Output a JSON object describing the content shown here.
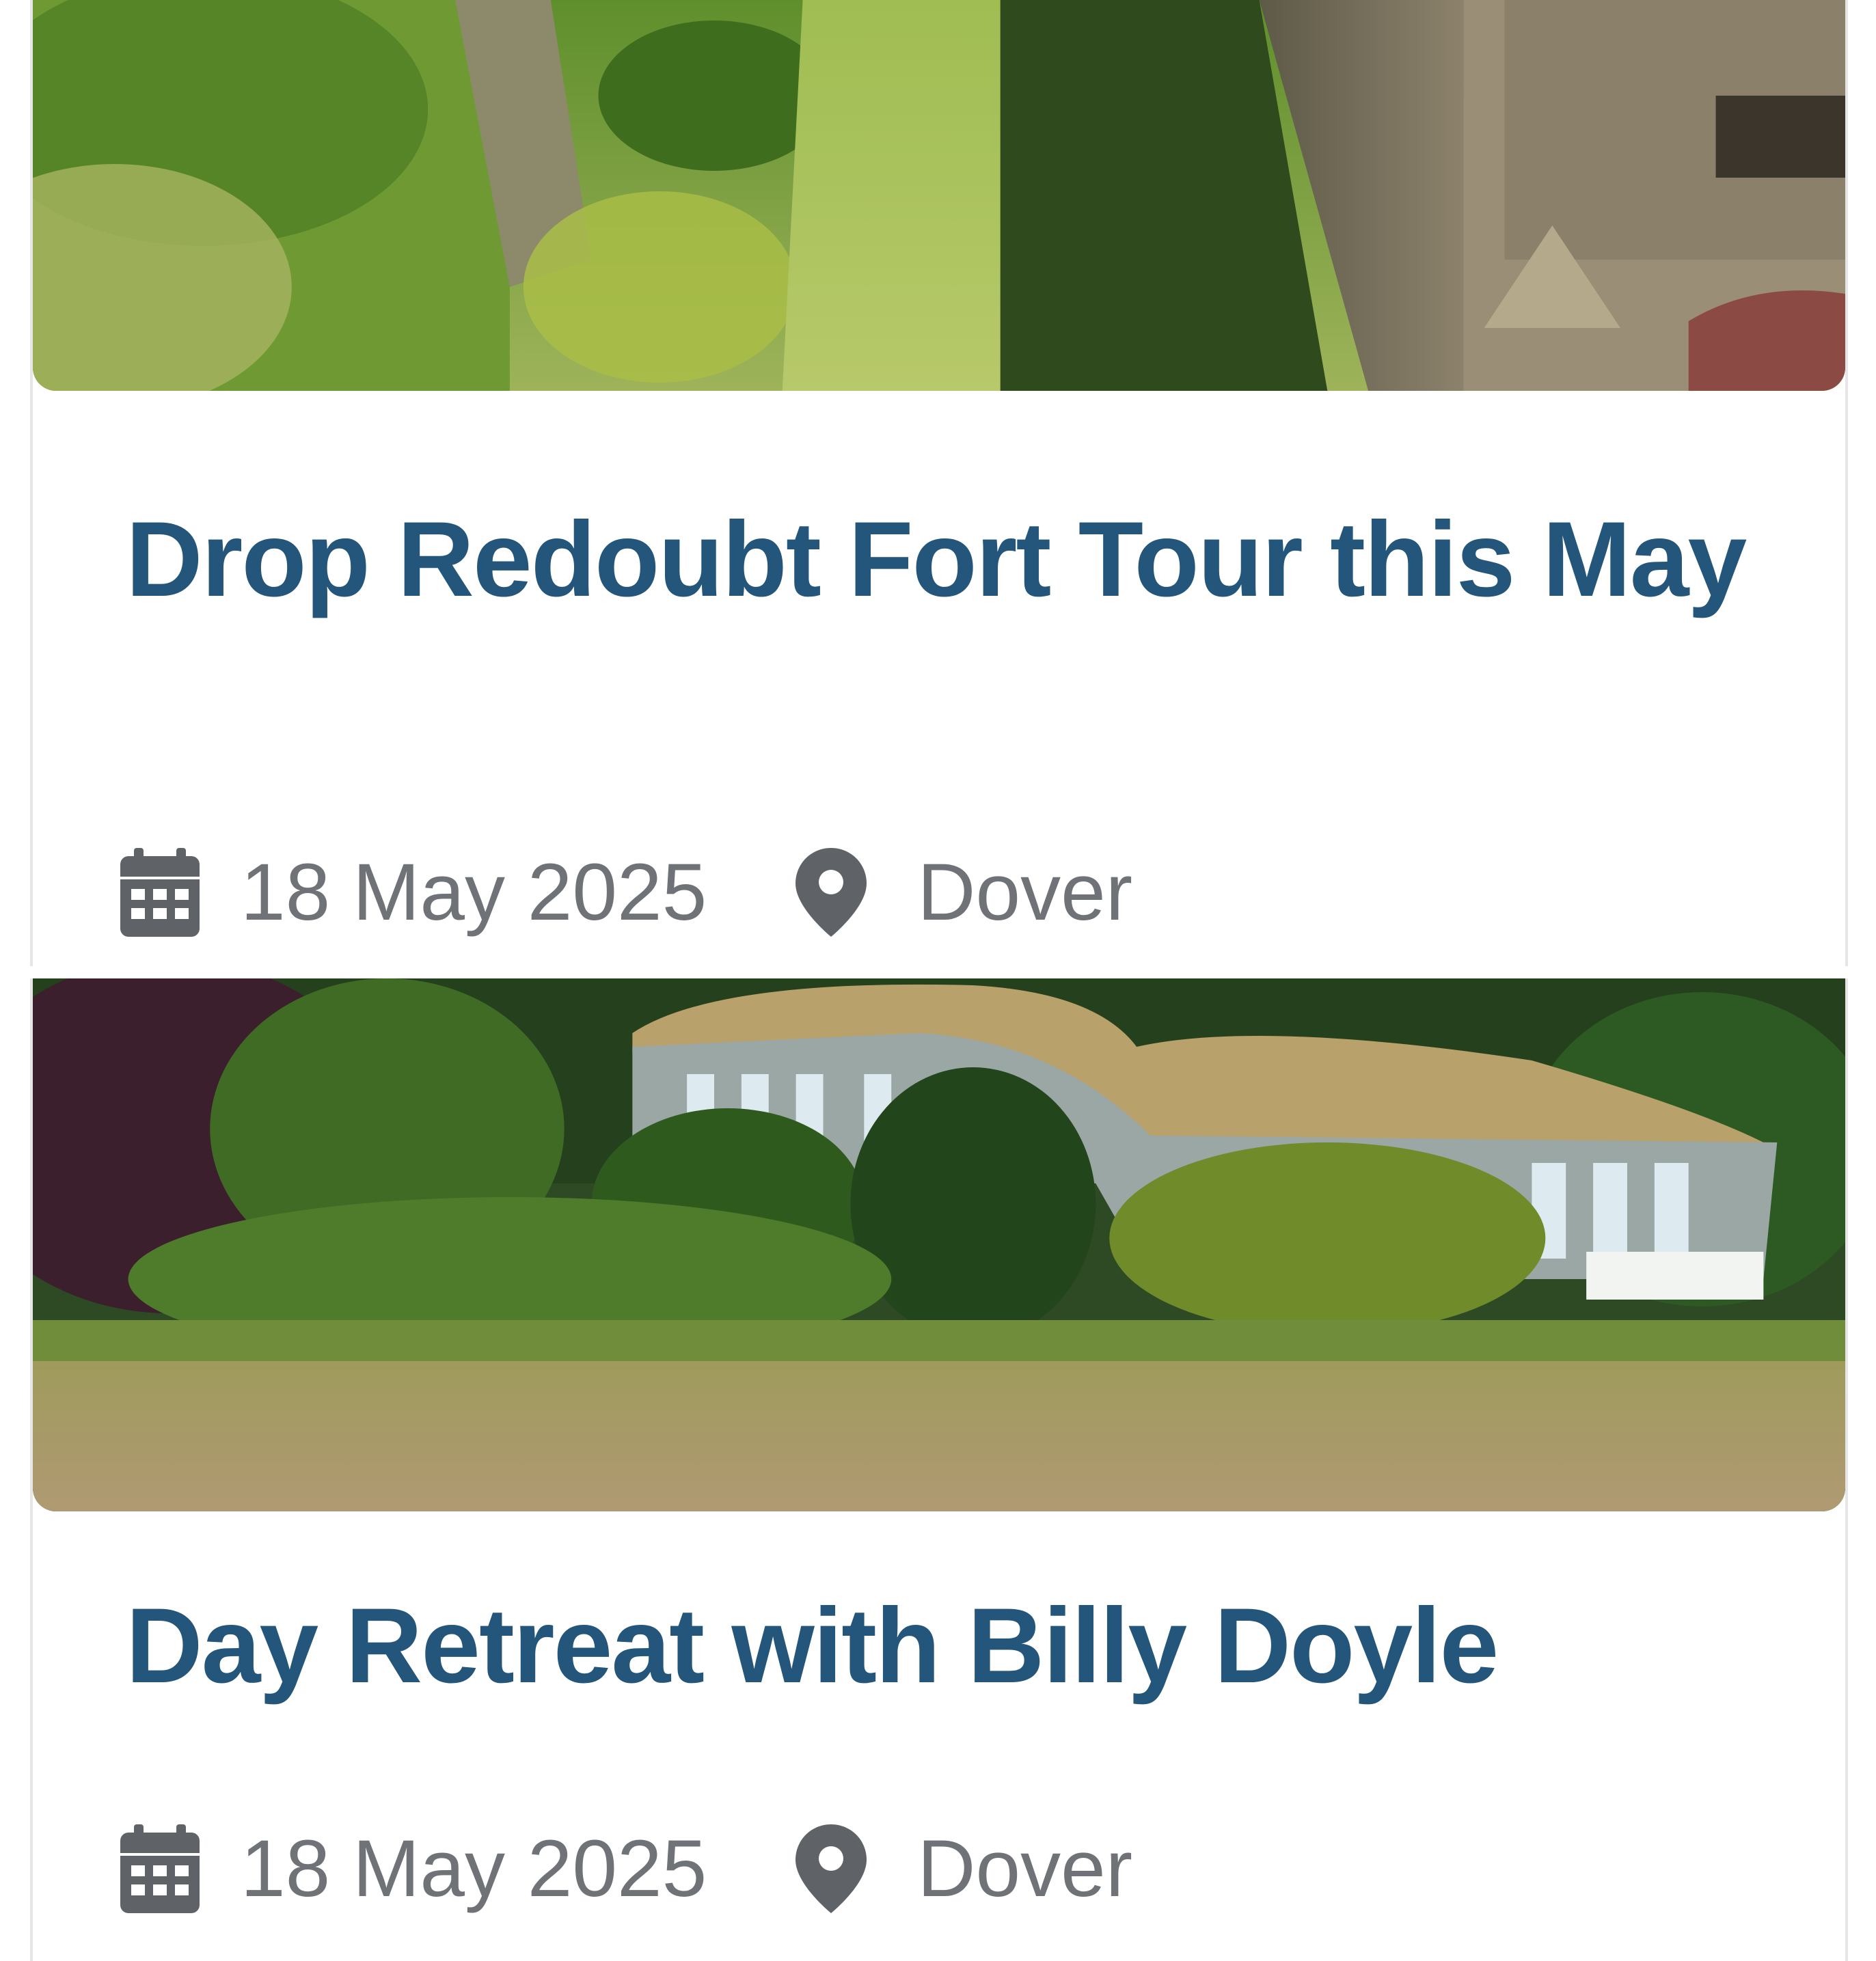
{
  "events": [
    {
      "title": "Drop Redoubt Fort Tour this May",
      "date": "18 May 2025",
      "location": "Dover",
      "image_alt": "Grassy moat beside stone fort walls",
      "date_icon": "calendar-icon",
      "location_icon": "map-pin-icon"
    },
    {
      "title": "Day Retreat with Billy Doyle",
      "date": "18 May 2025",
      "location": "Dover",
      "image_alt": "Curved building with grass roof among gardens",
      "date_icon": "calendar-icon",
      "location_icon": "map-pin-icon"
    }
  ],
  "colors": {
    "title": "#23567a",
    "meta": "#6f7378",
    "icon": "#5f6368"
  }
}
